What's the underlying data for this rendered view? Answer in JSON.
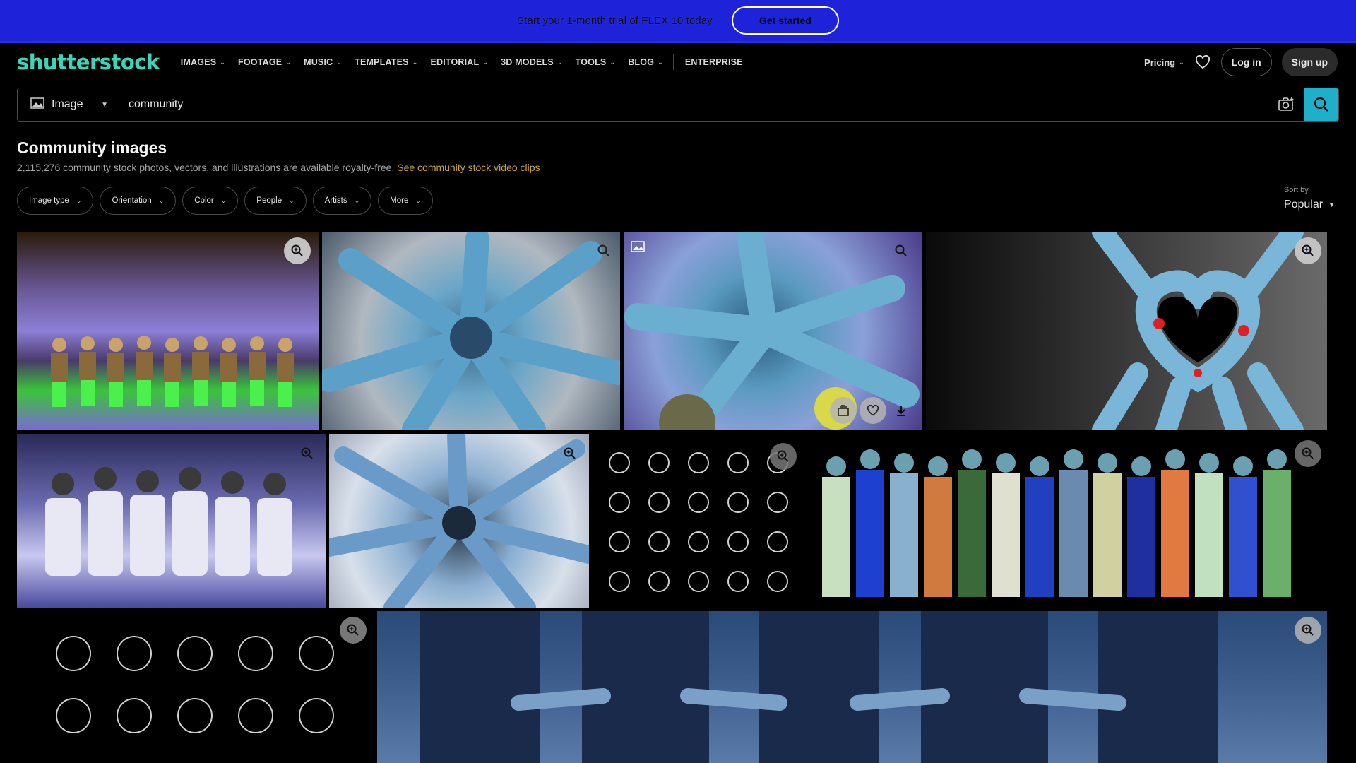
{
  "promo": {
    "text": "Start your 1-month trial of FLEX 10 today.",
    "button": "Get started"
  },
  "header": {
    "logo": "shutterstock",
    "nav": [
      {
        "label": "IMAGES",
        "dropdown": true
      },
      {
        "label": "FOOTAGE",
        "dropdown": true
      },
      {
        "label": "MUSIC",
        "dropdown": true
      },
      {
        "label": "TEMPLATES",
        "dropdown": true
      },
      {
        "label": "EDITORIAL",
        "dropdown": true
      },
      {
        "label": "3D MODELS",
        "dropdown": true
      },
      {
        "label": "TOOLS",
        "dropdown": true
      },
      {
        "label": "BLOG",
        "dropdown": true
      },
      {
        "label": "ENTERPRISE",
        "dropdown": false
      }
    ],
    "pricing": "Pricing",
    "login": "Log in",
    "signup": "Sign up"
  },
  "search": {
    "type": "Image",
    "value": "community"
  },
  "results": {
    "title": "Community images",
    "subtitle": "2,115,276 community stock photos, vectors, and illustrations are available royalty-free.",
    "link": "See community stock video clips"
  },
  "filters": [
    "Image type",
    "Orientation",
    "Color",
    "People",
    "Artists",
    "More"
  ],
  "sort": {
    "label": "Sort by",
    "value": "Popular"
  },
  "colors": {
    "brand": "#3ad6b8",
    "banner": "#1e22d9",
    "search_button": "#1db0c8",
    "link": "#c8a33a"
  }
}
